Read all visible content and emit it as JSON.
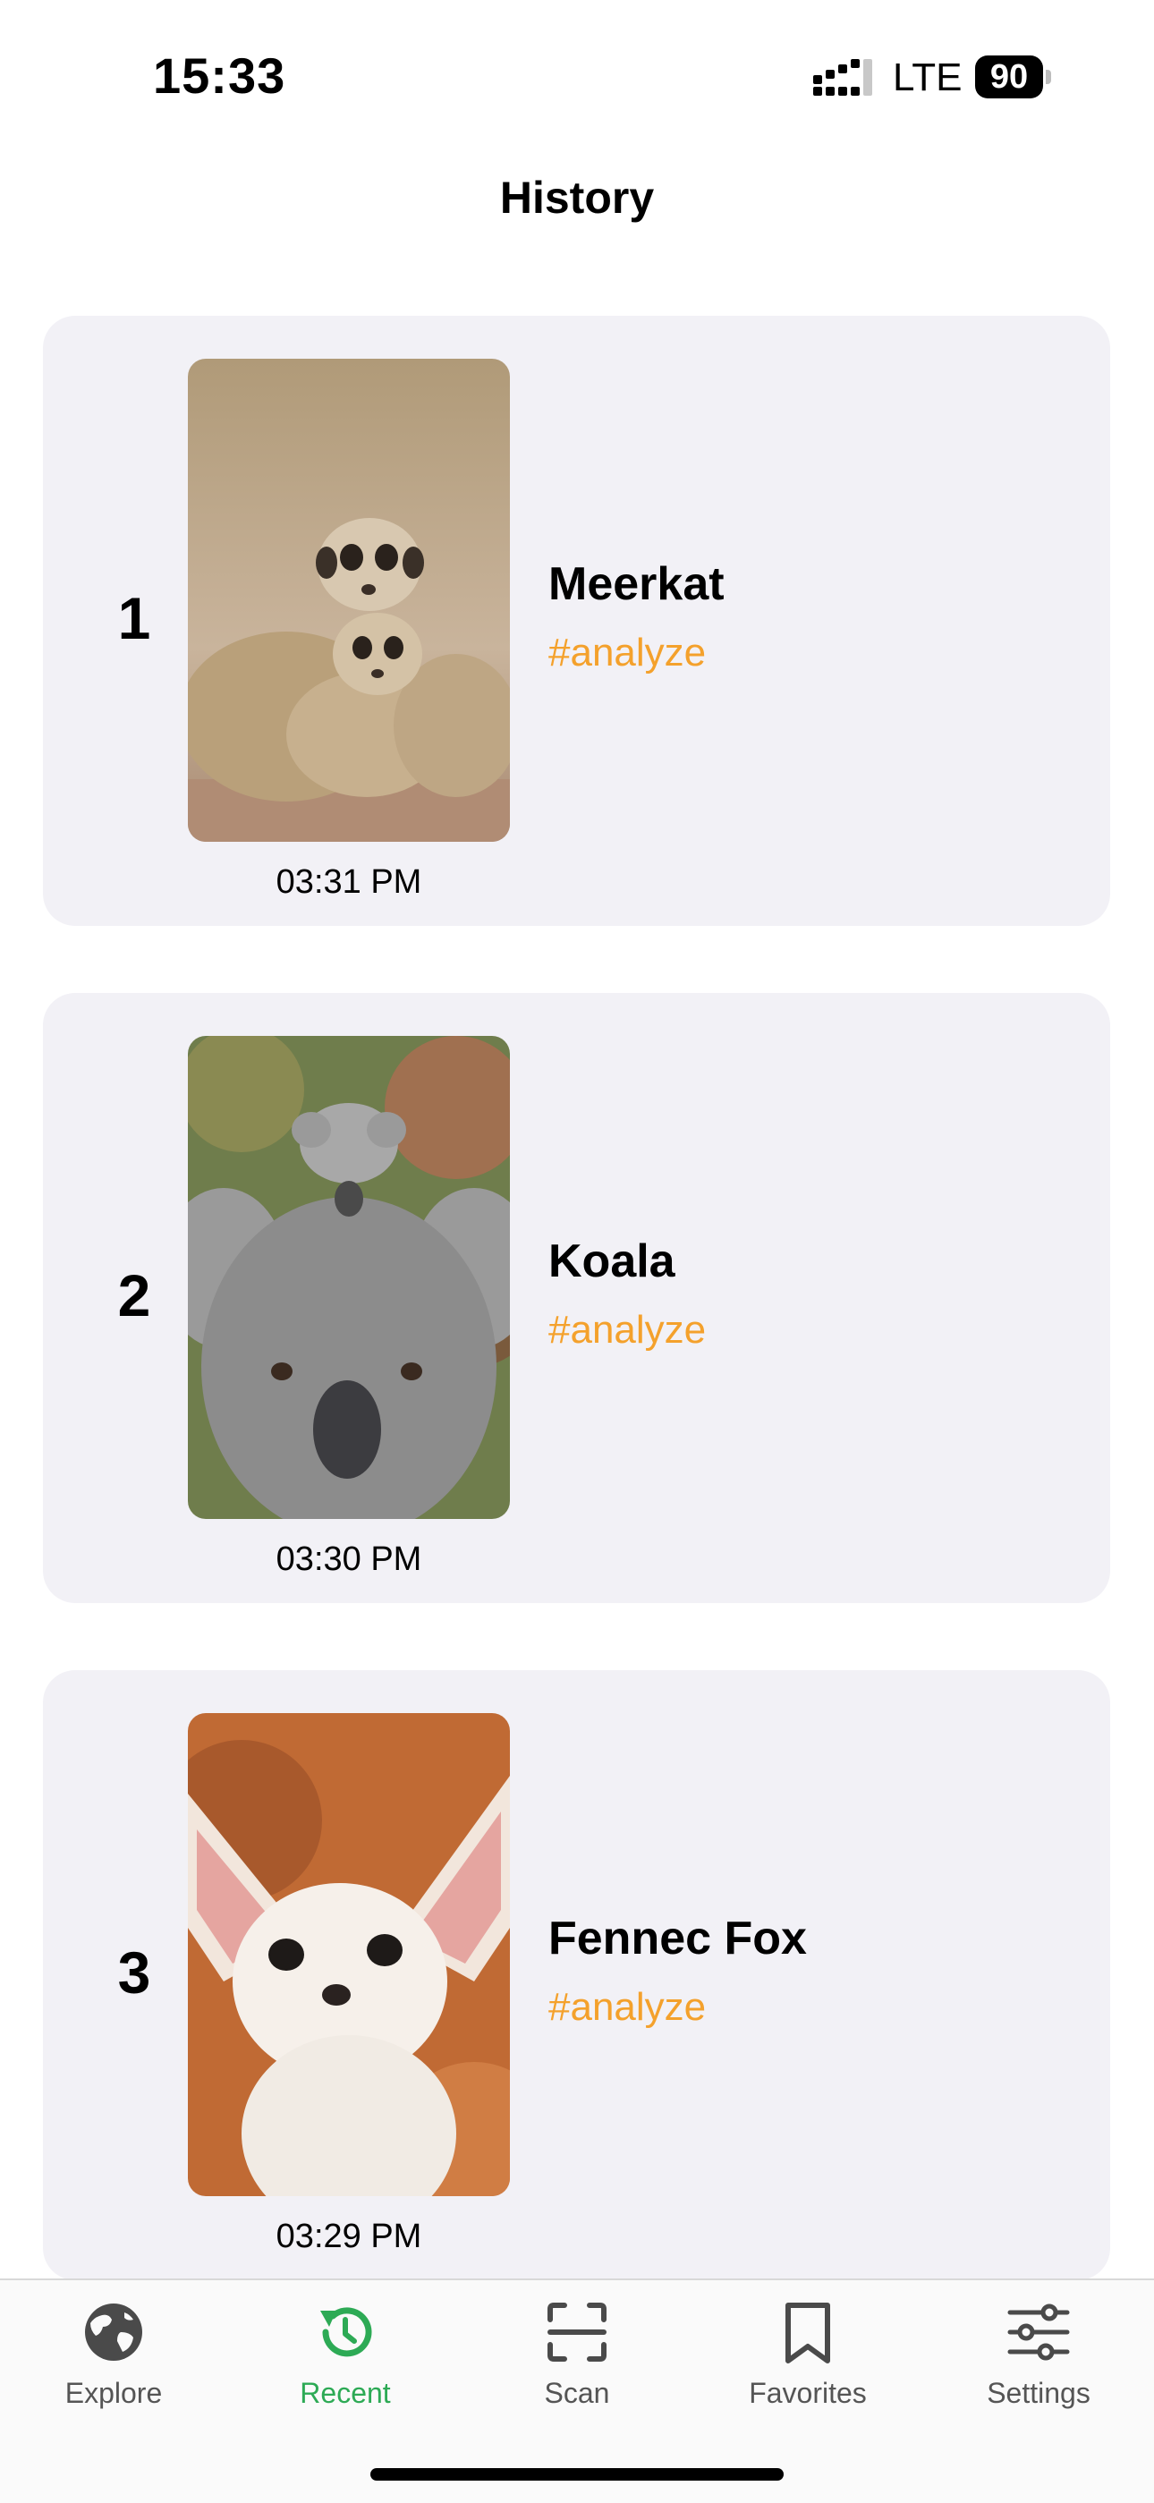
{
  "status_bar": {
    "time": "15:33",
    "network": "LTE",
    "battery": "90"
  },
  "page": {
    "title": "History"
  },
  "history": [
    {
      "rank": "1",
      "name": "Meerkat",
      "tag": "#analyze",
      "time": "03:31 PM",
      "photo": "meerkat-photo"
    },
    {
      "rank": "2",
      "name": "Koala",
      "tag": "#analyze",
      "time": "03:30 PM",
      "photo": "koala-photo"
    },
    {
      "rank": "3",
      "name": "Fennec Fox",
      "tag": "#analyze",
      "time": "03:29 PM",
      "photo": "fennec-fox-photo"
    }
  ],
  "tabs": [
    {
      "label": "Explore",
      "icon": "globe-icon",
      "active": false
    },
    {
      "label": "Recent",
      "icon": "history-icon",
      "active": true
    },
    {
      "label": "Scan",
      "icon": "scan-icon",
      "active": false
    },
    {
      "label": "Favorites",
      "icon": "bookmark-icon",
      "active": false
    },
    {
      "label": "Settings",
      "icon": "sliders-icon",
      "active": false
    }
  ],
  "colors": {
    "accent_tag": "#f4a12c",
    "active_tab": "#2daa55",
    "card_bg": "#f2f1f6"
  }
}
